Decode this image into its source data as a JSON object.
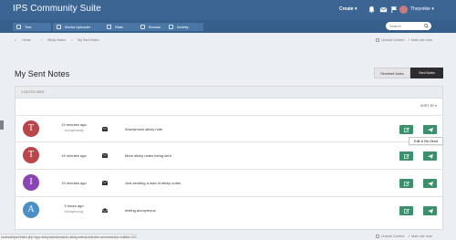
{
  "header": {
    "brand": "IPS Community Suite",
    "create_label": "Create ▾",
    "user_name": "Theyorkie ▾"
  },
  "nav": {
    "tabs": [
      {
        "label": "Test"
      },
      {
        "label": "Media Uploader"
      },
      {
        "label": "Stats"
      },
      {
        "label": "Browse"
      },
      {
        "label": "Activity"
      }
    ],
    "search_placeholder": "Search"
  },
  "breadcrumb": {
    "items": [
      "Home",
      "Sticky Notes",
      "My Sent Notes"
    ]
  },
  "top_links": {
    "unread": "Unread Content",
    "mark_read": "Mark site read"
  },
  "page": {
    "title": "My Sent Notes",
    "tab_received": "Received Notes",
    "tab_sent": "Sent Notes",
    "count_label": "4 NOTES SENT",
    "sort_label": "SORT BY ▾"
  },
  "notes": [
    {
      "initial": "T",
      "avatar_color": "#b9464a",
      "time": "19 minutes ago",
      "by": "Anonymously",
      "text": "Anonymous sticky note"
    },
    {
      "initial": "T",
      "avatar_color": "#b9464a",
      "time": "19 minutes ago",
      "by": "",
      "text": "More sticky notes being sent"
    },
    {
      "initial": "I",
      "avatar_color": "#8a44b5",
      "time": "19 minutes ago",
      "by": "",
      "text": "Just sending a load of sticky notes"
    },
    {
      "initial": "A",
      "avatar_color": "#4a8fc6",
      "time": "3 hours ago",
      "by": "Anonymously",
      "text": "testing anonymous"
    }
  ],
  "tooltip": "Edit & Re-Send",
  "status_url": "localhost/ips4/index.php?app=stickynotes&module=stickynotes&controller=sendnote&do=edit&id=222",
  "colors": {
    "header_bg": "#3d6594",
    "action_button": "#3d8f6e",
    "active_tab": "#2d2d2d"
  },
  "icons": {
    "bell": "bell-icon",
    "mail": "mail-icon",
    "edit": "edit-icon",
    "send": "send-icon"
  }
}
